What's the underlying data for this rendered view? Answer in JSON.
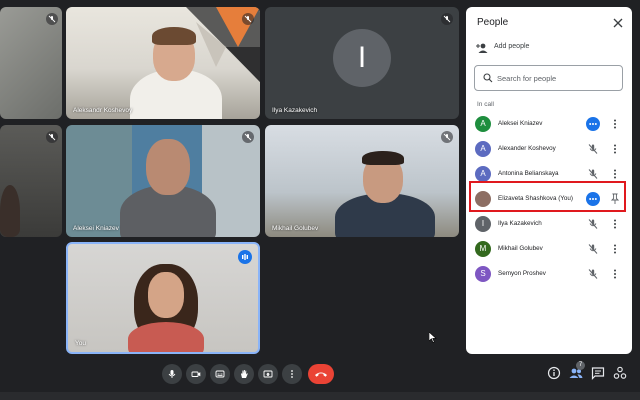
{
  "tiles": {
    "t2_name": "Aleksandr Koshevoy",
    "t3_name": "Ilya Kazakevich",
    "t3_initial": "I",
    "t5_name": "Aleksei Kniazev",
    "t6_name": "Mikhail Golubev",
    "t7_name": "You"
  },
  "panel": {
    "title": "People",
    "add_people_label": "Add people",
    "search_placeholder": "Search for people",
    "section_label": "In call",
    "participants": [
      {
        "initial": "A",
        "name": "Aleksei Kniazev",
        "color": "#1e8e3e",
        "mic": "talking"
      },
      {
        "initial": "A",
        "name": "Alexander Koshevoy",
        "color": "#5c6bc0",
        "mic": "muted"
      },
      {
        "initial": "A",
        "name": "Antonina Belianskaya",
        "color": "#5c6bc0",
        "mic": "muted"
      },
      {
        "initial": "",
        "name": "Elizaveta Shashkova (You)",
        "color": "#8d6e63",
        "mic": "talking"
      },
      {
        "initial": "I",
        "name": "Ilya Kazakevich",
        "color": "#5f6368",
        "mic": "muted"
      },
      {
        "initial": "M",
        "name": "Mikhail Golubev",
        "color": "#33691e",
        "mic": "muted"
      },
      {
        "initial": "S",
        "name": "Semyon Proshev",
        "color": "#7e57c2",
        "mic": "muted"
      }
    ]
  },
  "toolbar": {
    "buttons": [
      "mic-icon",
      "camera-icon",
      "captions-icon",
      "raise-hand-icon",
      "present-icon",
      "more-options-icon",
      "end-call-icon"
    ],
    "right_icons": [
      "info-icon",
      "people-icon",
      "chat-icon",
      "activities-icon"
    ],
    "people_count": "7"
  },
  "colors": {
    "accent": "#1a73e8",
    "end_call": "#ea4335",
    "highlight_box": "#e0191e",
    "background": "#202124"
  }
}
